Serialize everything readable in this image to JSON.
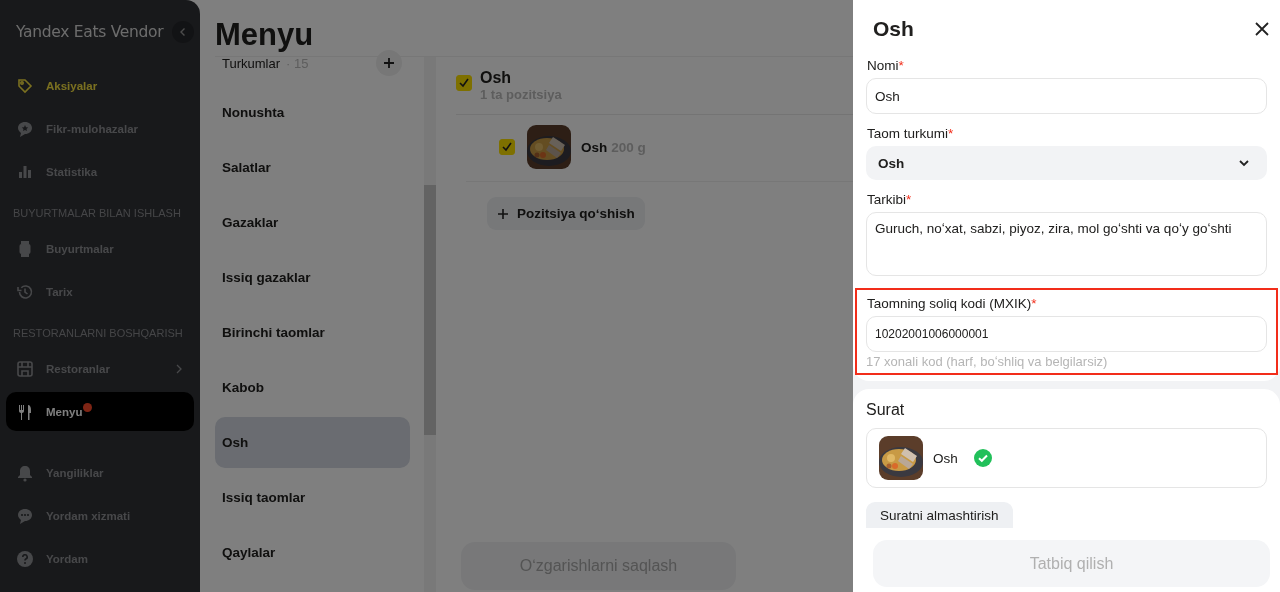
{
  "sidebar": {
    "brand": "Yandex Eats Vendor",
    "items": [
      {
        "kind": "item",
        "label": "Aksiyalar",
        "highlighted": true,
        "selected": false,
        "has_submenu": false,
        "notification": false
      },
      {
        "kind": "item",
        "label": "Fikr-mulohazalar",
        "highlighted": false,
        "selected": false,
        "has_submenu": false,
        "notification": false
      },
      {
        "kind": "item",
        "label": "Statistika",
        "highlighted": false,
        "selected": false,
        "has_submenu": false,
        "notification": false
      },
      {
        "kind": "section",
        "label": "BUYURTMALAR BILAN ISHLASH"
      },
      {
        "kind": "item",
        "label": "Buyurtmalar",
        "highlighted": false,
        "selected": false,
        "has_submenu": false,
        "notification": false
      },
      {
        "kind": "item",
        "label": "Tarix",
        "highlighted": false,
        "selected": false,
        "has_submenu": false,
        "notification": false
      },
      {
        "kind": "section",
        "label": "RESTORANLARNI BOSHQARISH"
      },
      {
        "kind": "item",
        "label": "Restoranlar",
        "highlighted": false,
        "selected": false,
        "has_submenu": true,
        "notification": false
      },
      {
        "kind": "item",
        "label": "Menyu",
        "highlighted": false,
        "selected": true,
        "has_submenu": false,
        "notification": true
      },
      {
        "kind": "item",
        "label": "Yangiliklar",
        "highlighted": false,
        "selected": false,
        "has_submenu": false,
        "notification": false
      },
      {
        "kind": "item",
        "label": "Yordam xizmati",
        "highlighted": false,
        "selected": false,
        "has_submenu": false,
        "notification": false
      },
      {
        "kind": "item",
        "label": "Yordam",
        "highlighted": false,
        "selected": false,
        "has_submenu": false,
        "notification": false
      }
    ]
  },
  "page": {
    "title": "Menyu"
  },
  "categories": {
    "heading": "Turkumlar",
    "count": "· 15",
    "items": [
      {
        "label": "Nonushta",
        "selected": false
      },
      {
        "label": "Salatlar",
        "selected": false
      },
      {
        "label": "Gazaklar",
        "selected": false
      },
      {
        "label": "Issiq gazaklar",
        "selected": false
      },
      {
        "label": "Birinchi taomlar",
        "selected": false
      },
      {
        "label": "Kabob",
        "selected": false
      },
      {
        "label": "Osh",
        "selected": true
      },
      {
        "label": "Issiq taomlar",
        "selected": false
      },
      {
        "label": "Qaylalar",
        "selected": false
      }
    ]
  },
  "group": {
    "checked": true,
    "name": "Osh",
    "count_label": "1 ta pozitsiya",
    "positions": [
      {
        "checked": true,
        "name": "Osh",
        "weight": "200 g"
      }
    ],
    "add_button": "Pozitsiya qoʻshish"
  },
  "save_button": {
    "label": "Oʻzgarishlarni saqlash",
    "disabled": true
  },
  "panel": {
    "title": "Osh",
    "fields": [
      {
        "kind": "text",
        "label": "Nomi",
        "required_mark": "*",
        "value": "Osh",
        "highlighted": false
      },
      {
        "kind": "select",
        "label": "Taom turkumi",
        "required_mark": "*",
        "value": "Osh",
        "highlighted": false
      },
      {
        "kind": "textarea",
        "label": "Tarkibi",
        "required_mark": "*",
        "value": "Guruch, noʻxat, sabzi, piyoz, zira, mol goʻshti va qoʻy goʻshti",
        "highlighted": false
      },
      {
        "kind": "text",
        "label": "Taomning soliq kodi (MXIK)",
        "required_mark": "*",
        "value": "10202001006000001",
        "hint": "17 xonali kod (harf, boʻshliq va belgilarsiz)",
        "highlighted": true
      }
    ],
    "photo": {
      "heading": "Surat",
      "file_name": "Osh",
      "verified": true,
      "replace_button": "Suratni almashtirish"
    },
    "apply_button": {
      "label": "Tatbiq qilish",
      "disabled": true
    }
  }
}
